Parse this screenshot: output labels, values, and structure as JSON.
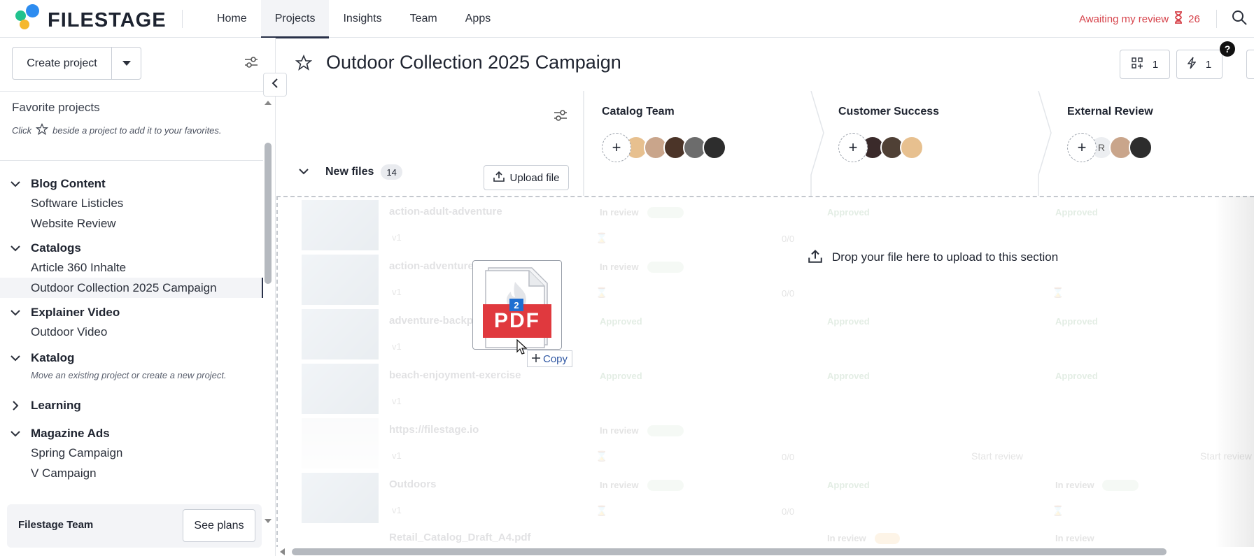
{
  "brand": {
    "name": "FILESTAGE",
    "colors": {
      "dot_blue": "#2d8cf0",
      "dot_yellow": "#f5b82e",
      "dot_green": "#21c28e",
      "accent_red": "#d6434b"
    }
  },
  "nav": {
    "items": [
      "Home",
      "Projects",
      "Insights",
      "Team",
      "Apps"
    ],
    "active": "Projects"
  },
  "header_right": {
    "awaiting_label": "Awaiting my review",
    "awaiting_count": "26"
  },
  "sidebar": {
    "create_label": "Create project",
    "favorites_title": "Favorite projects",
    "favorites_hint_pre": "Click",
    "favorites_hint_post": "beside a project to add it to your favorites.",
    "groups": [
      {
        "name": "Blog Content",
        "expanded": true,
        "projects": [
          "Software Listicles",
          "Website Review"
        ]
      },
      {
        "name": "Catalogs",
        "expanded": true,
        "projects": [
          "Article 360 Inhalte",
          "Outdoor Collection 2025 Campaign"
        ]
      },
      {
        "name": "Explainer Video",
        "expanded": true,
        "projects": [
          "Outdoor Video"
        ]
      },
      {
        "name": "Katalog",
        "expanded": true,
        "hint": "Move an existing project or create a new project."
      },
      {
        "name": "Learning",
        "expanded": false
      },
      {
        "name": "Magazine Ads",
        "expanded": true,
        "projects": [
          "Spring Campaign",
          "V Campaign"
        ]
      }
    ],
    "active_project": "Outdoor Collection 2025 Campaign",
    "footer_team": "Filestage Team",
    "see_plans": "See plans"
  },
  "main": {
    "title": "Outdoor Collection 2025 Campaign",
    "help_badge": "?",
    "view_count": "1",
    "automation_count": "1",
    "section_name": "New files",
    "section_count": "14",
    "upload_label": "Upload file",
    "stages": [
      {
        "name": "Catalog Team"
      },
      {
        "name": "Customer Success"
      },
      {
        "name": "External Review",
        "initial": "R"
      }
    ],
    "drop_message": "Drop your file here to upload to this section",
    "drag": {
      "badge": "2",
      "file_type": "PDF",
      "copy_label": "Copy"
    },
    "files": [
      {
        "name": "action-adult-adventure",
        "version": "v1",
        "s1": "In review",
        "s2": "Approved",
        "s3": "Approved",
        "frac1": "0/0"
      },
      {
        "name": "action-adventure",
        "version": "v1",
        "s1": "In review",
        "s2": "",
        "s3": "",
        "frac1": "0/0"
      },
      {
        "name": "adventure-backpack",
        "version": "v1",
        "s1": "Approved",
        "s2": "Approved",
        "s3": "Approved"
      },
      {
        "name": "beach-enjoyment-exercise",
        "version": "v1",
        "s1": "Approved",
        "s2": "Approved",
        "s3": "Approved"
      },
      {
        "name": "https://filestage.io",
        "version": "v1",
        "s1": "In review",
        "s2": "",
        "s3": "",
        "frac1": "0/0",
        "start2": "Start review",
        "start3": "Start review"
      },
      {
        "name": "Outdoors",
        "version": "v1",
        "s1": "In review",
        "s2": "Approved",
        "s3": "In review",
        "frac1": "0/0"
      },
      {
        "name": "Retail_Catalog_Draft_A4.pdf",
        "version": "",
        "s1": "",
        "s2": "In review",
        "s3": "In review"
      }
    ]
  }
}
